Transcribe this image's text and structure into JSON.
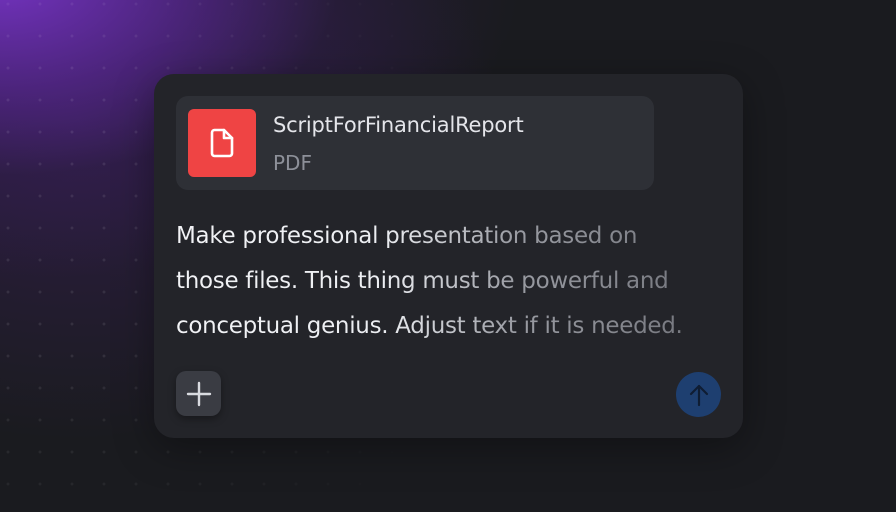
{
  "composer": {
    "attachment": {
      "icon": "pdf-file-icon",
      "name": "ScriptForFinancialReport",
      "type": "PDF",
      "icon_color": "#ef4444"
    },
    "prompt_text": "Make professional presentation based on\nthose files. This thing must be powerful and\nconceptual genius. Adjust text if it is needed.",
    "add_button": {
      "icon": "plus-icon"
    },
    "send_button": {
      "icon": "arrow-up-icon",
      "color": "#1e3f70"
    }
  }
}
